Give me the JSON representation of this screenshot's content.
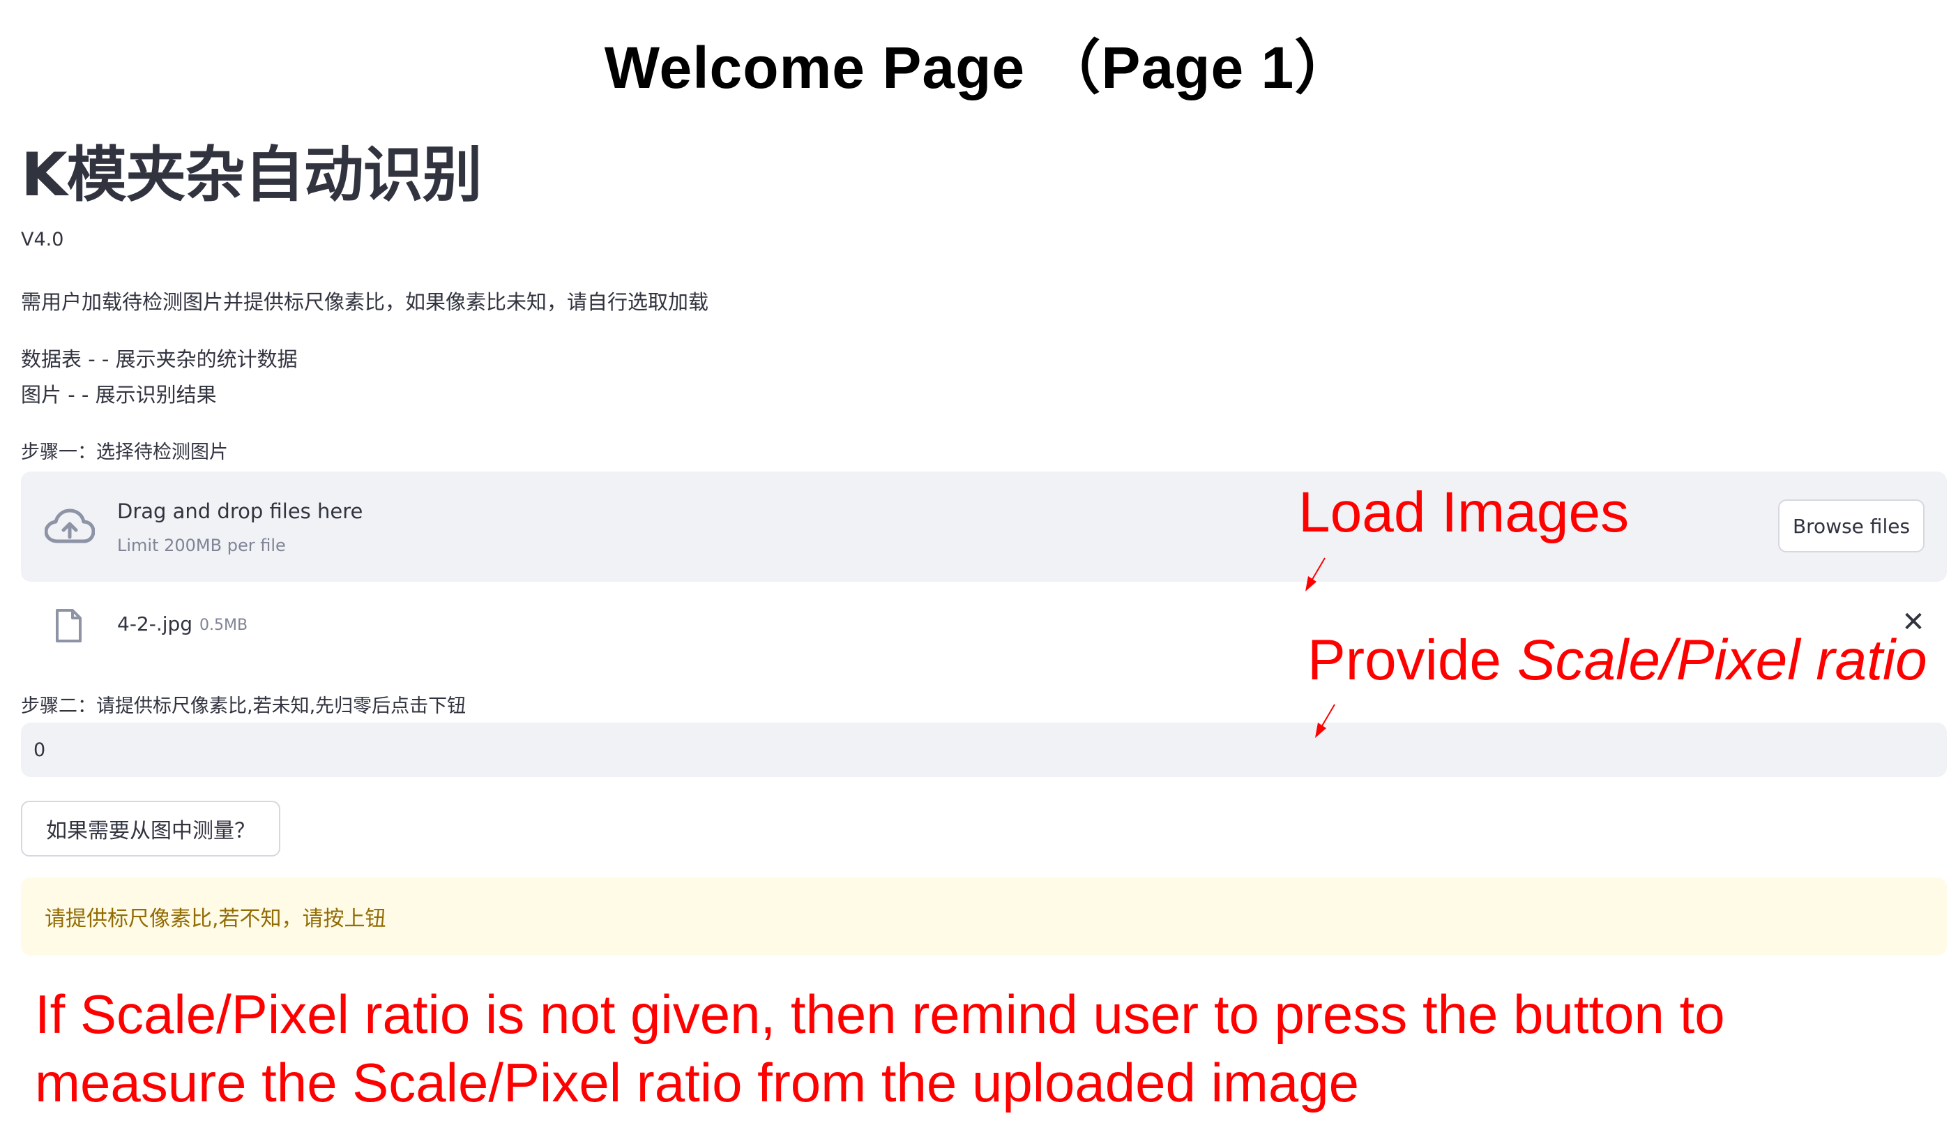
{
  "slide": {
    "title": "Welcome Page （Page 1）"
  },
  "app": {
    "title": "K模夹杂自动识别",
    "version": "V4.0",
    "description": "需用户加载待检测图片并提供标尺像素比，如果像素比未知，请自行选取加载",
    "info_line1": "数据表 - - 展示夹杂的统计数据",
    "info_line2": "图片 - - 展示识别结果"
  },
  "step1": {
    "label": "步骤一：选择待检测图片",
    "dropzone_text": "Drag and drop files here",
    "dropzone_limit": "Limit 200MB per file",
    "browse_label": "Browse files",
    "upload_icon": "cloud-upload-icon"
  },
  "uploaded_file": {
    "name": "4-2-.jpg",
    "size": "0.5MB",
    "file_icon": "file-icon",
    "close_glyph": "✕"
  },
  "step2": {
    "label": "步骤二：请提供标尺像素比,若未知,先归零后点击下钮",
    "value": "0"
  },
  "measure_button": {
    "label": "如果需要从图中测量？"
  },
  "warning": {
    "text": "请提供标尺像素比,若不知，请按上钮",
    "bg_color": "#fffbe6",
    "text_color": "#926c05"
  },
  "annotations": {
    "color": "#ff0000",
    "load_images": "Load Images",
    "provide_prefix": "Provide ",
    "provide_italic": "Scale/Pixel ratio",
    "bottom_note_line1": "If Scale/Pixel ratio is not given, then remind user to press the button to",
    "bottom_note_line2": "measure the Scale/Pixel ratio from the uploaded image"
  }
}
